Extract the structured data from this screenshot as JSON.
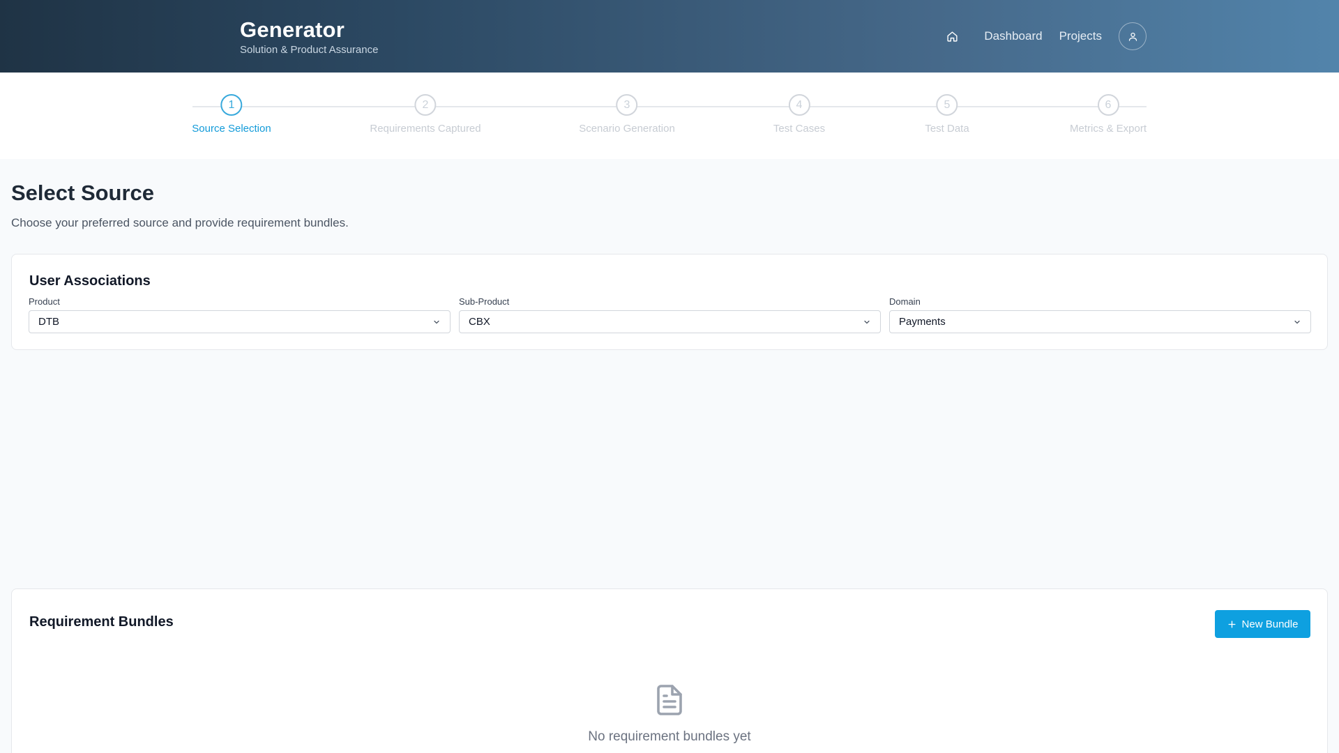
{
  "header": {
    "title": "Generator",
    "subtitle": "Solution & Product Assurance",
    "nav": {
      "home_icon": "home-icon",
      "dashboard": "Dashboard",
      "projects": "Projects",
      "user_icon": "user-icon"
    }
  },
  "stepper": {
    "active_step": 1,
    "steps": [
      {
        "number": "1",
        "label": "Source Selection"
      },
      {
        "number": "2",
        "label": "Requirements Captured"
      },
      {
        "number": "3",
        "label": "Scenario Generation"
      },
      {
        "number": "4",
        "label": "Test Cases"
      },
      {
        "number": "5",
        "label": "Test Data"
      },
      {
        "number": "6",
        "label": "Metrics & Export"
      }
    ]
  },
  "page": {
    "title": "Select Source",
    "description": "Choose your preferred source and provide requirement bundles."
  },
  "associations": {
    "title": "User Associations",
    "fields": [
      {
        "label": "Product",
        "value": "DTB"
      },
      {
        "label": "Sub-Product",
        "value": "CBX"
      },
      {
        "label": "Domain",
        "value": "Payments"
      }
    ]
  },
  "bundles": {
    "title": "Requirement Bundles",
    "new_button": "New Bundle",
    "empty_icon": "document-icon",
    "empty_text": "No requirement bundles yet"
  },
  "colors": {
    "accent": "#0ea0e0",
    "header_start": "#1f3345",
    "header_end": "#5284ab"
  }
}
